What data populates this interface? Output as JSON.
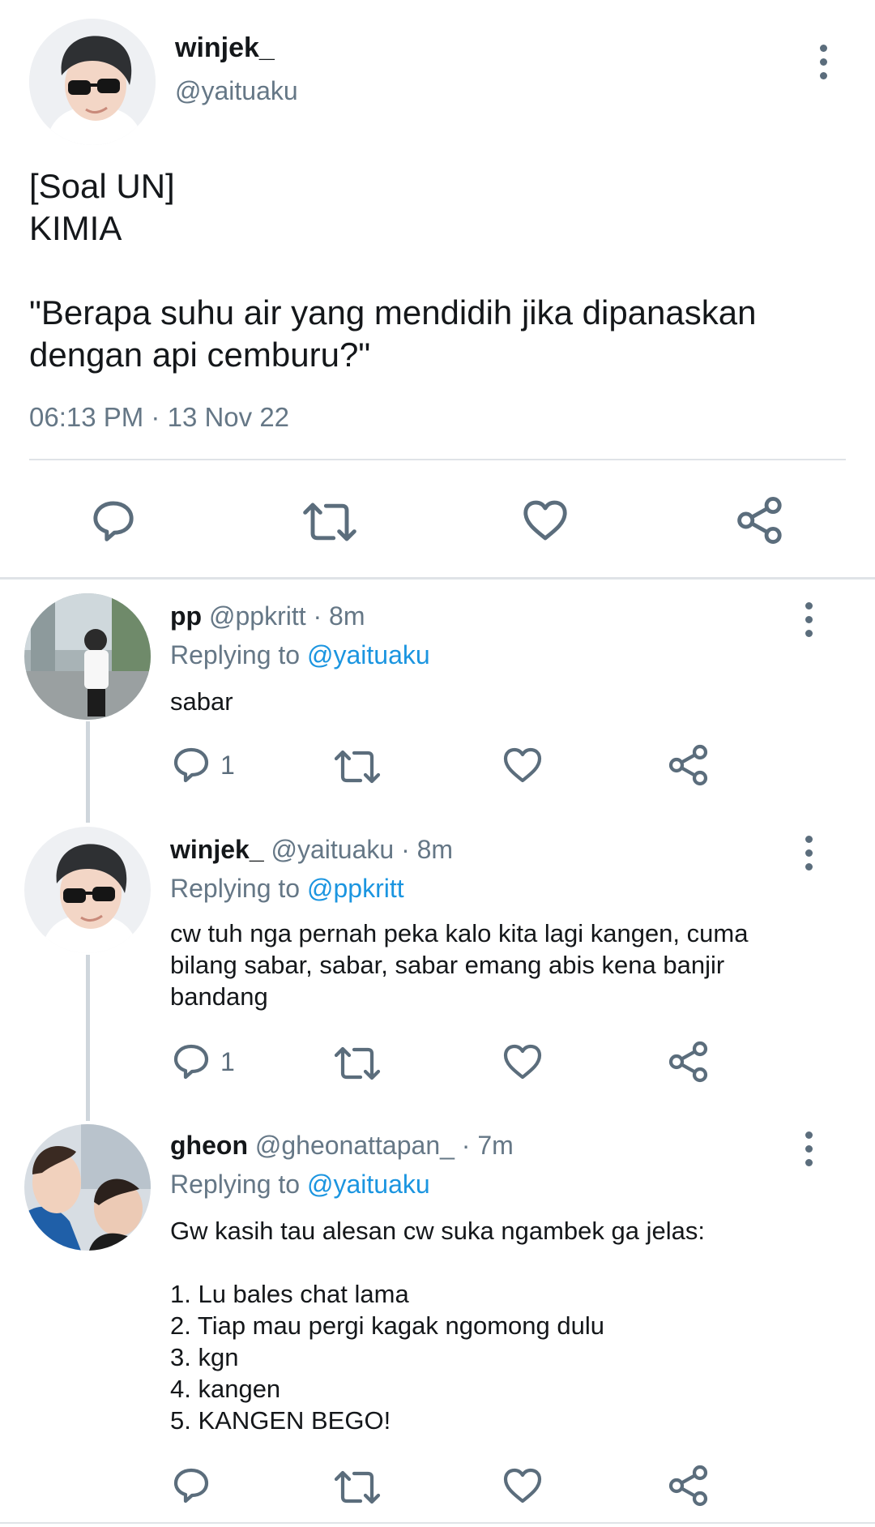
{
  "main_tweet": {
    "display_name": "winjek_",
    "handle": "@yaituaku",
    "text": "[Soal UN]\nKIMIA\n\n\"Berapa suhu air yang mendidih jika dipanaskan dengan api cemburu?\"",
    "time": "06:13 PM",
    "sep": "·",
    "date": "13 Nov 22"
  },
  "replies": [
    {
      "display_name": "pp",
      "handle": "@ppkritt",
      "sep": "·",
      "age": "8m",
      "replying_label": "Replying to",
      "replying_to": "@yaituaku",
      "text": "sabar",
      "reply_count": "1"
    },
    {
      "display_name": "winjek_",
      "handle": "@yaituaku",
      "sep": "·",
      "age": "8m",
      "replying_label": "Replying to",
      "replying_to": "@ppkritt",
      "text": "cw tuh nga pernah peka kalo kita lagi kangen, cuma bilang sabar, sabar, sabar emang abis kena banjir bandang",
      "reply_count": "1"
    },
    {
      "display_name": "gheon",
      "handle": "@gheonattapan_",
      "sep": "·",
      "age": "7m",
      "replying_label": "Replying to",
      "replying_to": "@yaituaku",
      "text": "Gw kasih tau alesan cw suka ngambek ga jelas:\n\n1. Lu bales chat lama\n2. Tiap mau pergi kagak ngomong dulu\n3. kgn\n4. kangen\n5. KANGEN BEGO!",
      "reply_count": ""
    }
  ],
  "icons": {
    "reply": "speech-bubble-icon",
    "retweet": "retweet-icon",
    "like": "heart-icon",
    "share": "share-icon",
    "more": "vertical-dots-icon"
  },
  "colors": {
    "text": "#14171a",
    "muted": "#657786",
    "link": "#1b95e0",
    "icon": "#5b6d7c",
    "divider": "#dfe3e7"
  }
}
